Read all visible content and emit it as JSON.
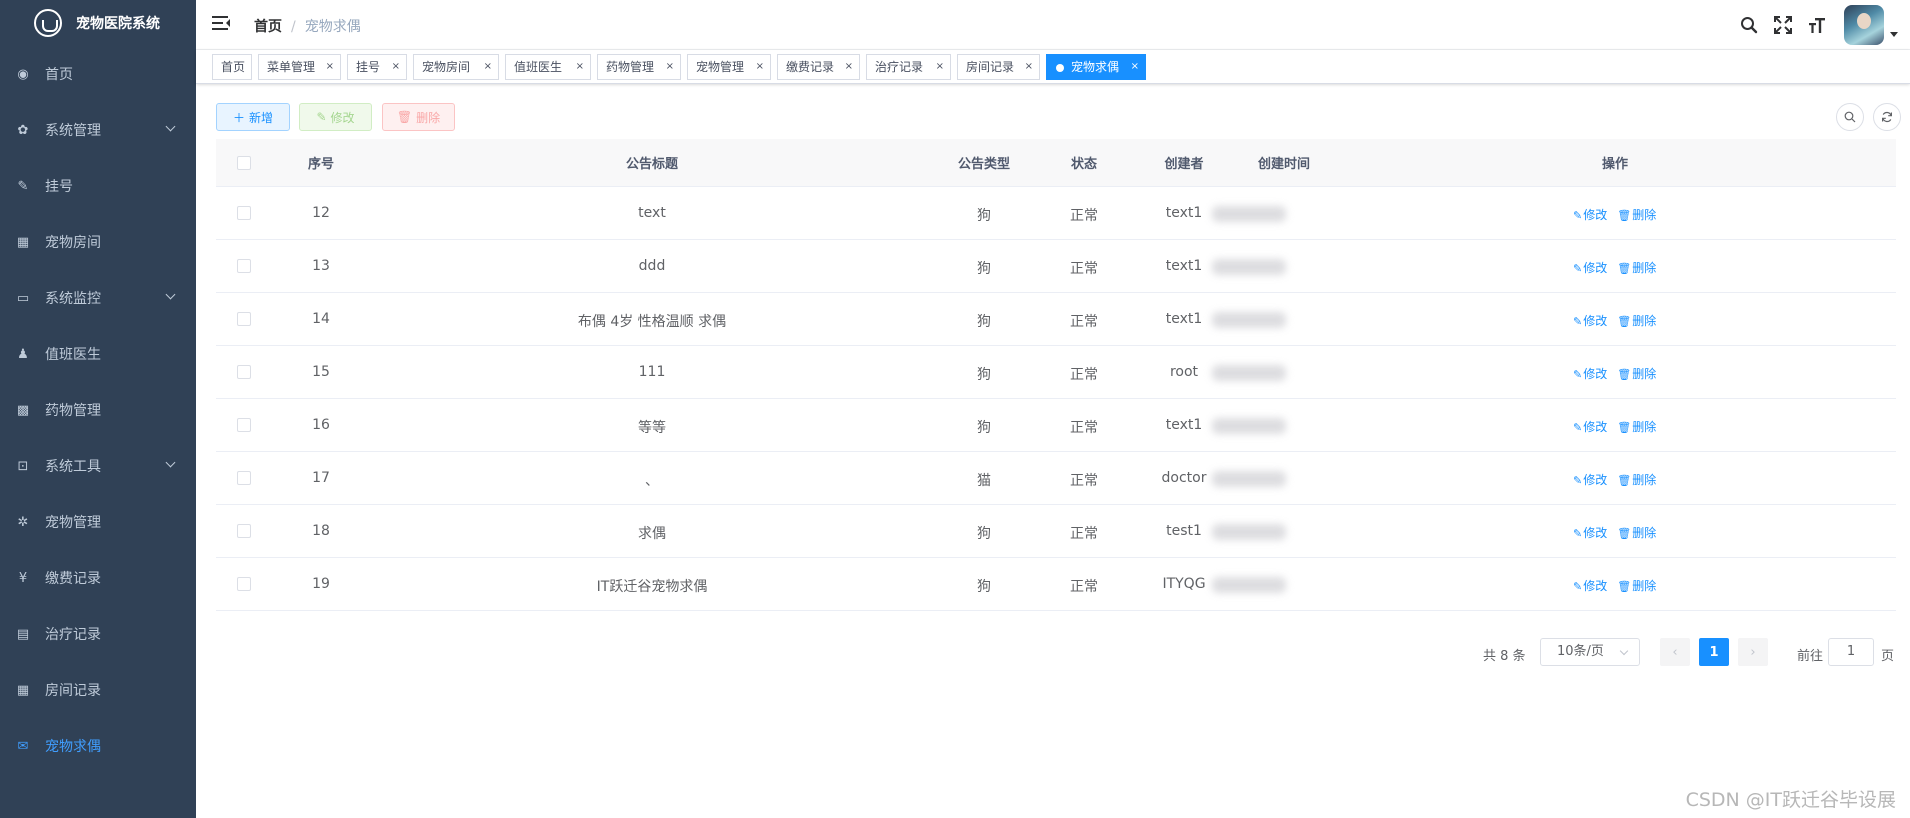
{
  "app": {
    "title": "宠物医院系统"
  },
  "sidebar": {
    "items": [
      {
        "label": "首页",
        "icon": "dashboard-icon",
        "glyph": "◉",
        "expandable": false,
        "active": false
      },
      {
        "label": "系统管理",
        "icon": "gear-icon",
        "glyph": "✿",
        "expandable": true,
        "active": false
      },
      {
        "label": "挂号",
        "icon": "edit-icon",
        "glyph": "✎",
        "expandable": false,
        "active": false
      },
      {
        "label": "宠物房间",
        "icon": "table-icon",
        "glyph": "▦",
        "expandable": false,
        "active": false
      },
      {
        "label": "系统监控",
        "icon": "monitor-icon",
        "glyph": "▭",
        "expandable": true,
        "active": false
      },
      {
        "label": "值班医生",
        "icon": "peoples-icon",
        "glyph": "♟",
        "expandable": false,
        "active": false
      },
      {
        "label": "药物管理",
        "icon": "grid-icon",
        "glyph": "▩",
        "expandable": false,
        "active": false
      },
      {
        "label": "系统工具",
        "icon": "toolbox-icon",
        "glyph": "⊡",
        "expandable": true,
        "active": false
      },
      {
        "label": "宠物管理",
        "icon": "bug-icon",
        "glyph": "✲",
        "expandable": false,
        "active": false
      },
      {
        "label": "缴费记录",
        "icon": "yen-icon",
        "glyph": "¥",
        "expandable": false,
        "active": false
      },
      {
        "label": "治疗记录",
        "icon": "document-icon",
        "glyph": "▤",
        "expandable": false,
        "active": false
      },
      {
        "label": "房间记录",
        "icon": "table-icon",
        "glyph": "▦",
        "expandable": false,
        "active": false
      },
      {
        "label": "宠物求偶",
        "icon": "message-icon",
        "glyph": "✉",
        "expandable": false,
        "active": true
      }
    ]
  },
  "breadcrumb": {
    "home": "首页",
    "separator": "/",
    "current": "宠物求偶"
  },
  "tags": [
    {
      "label": "首页",
      "closable": false,
      "active": false
    },
    {
      "label": "菜单管理",
      "closable": true,
      "active": false
    },
    {
      "label": "挂号",
      "closable": true,
      "active": false
    },
    {
      "label": "宠物房间",
      "closable": true,
      "active": false
    },
    {
      "label": "值班医生",
      "closable": true,
      "active": false
    },
    {
      "label": "药物管理",
      "closable": true,
      "active": false
    },
    {
      "label": "宠物管理",
      "closable": true,
      "active": false
    },
    {
      "label": "缴费记录",
      "closable": true,
      "active": false
    },
    {
      "label": "治疗记录",
      "closable": true,
      "active": false
    },
    {
      "label": "房间记录",
      "closable": true,
      "active": false
    },
    {
      "label": "宠物求偶",
      "closable": true,
      "active": true
    }
  ],
  "toolbar": {
    "add_label": "新增",
    "edit_label": "修改",
    "delete_label": "删除"
  },
  "table": {
    "headers": {
      "index": "序号",
      "title": "公告标题",
      "type": "公告类型",
      "status": "状态",
      "creator": "创建者",
      "created": "创建时间",
      "actions": "操作"
    },
    "rows": [
      {
        "id": "12",
        "title": "text",
        "type": "狗",
        "status": "正常",
        "creator": "text1"
      },
      {
        "id": "13",
        "title": "ddd",
        "type": "狗",
        "status": "正常",
        "creator": "text1"
      },
      {
        "id": "14",
        "title": "布偶 4岁 性格温顺 求偶",
        "type": "狗",
        "status": "正常",
        "creator": "text1"
      },
      {
        "id": "15",
        "title": "111",
        "type": "狗",
        "status": "正常",
        "creator": "root"
      },
      {
        "id": "16",
        "title": "等等",
        "type": "狗",
        "status": "正常",
        "creator": "text1"
      },
      {
        "id": "17",
        "title": "、",
        "type": "猫",
        "status": "正常",
        "creator": "doctor"
      },
      {
        "id": "18",
        "title": "求偶",
        "type": "狗",
        "status": "正常",
        "creator": "test1"
      },
      {
        "id": "19",
        "title": "IT跃迁谷宠物求偶",
        "type": "狗",
        "status": "正常",
        "creator": "ITYQG"
      }
    ],
    "edit_label": "修改",
    "delete_label": "删除"
  },
  "pagination": {
    "total": "共 8 条",
    "page_size": "10条/页",
    "current_page": "1",
    "goto_label": "前往",
    "goto_value": "1",
    "page_suffix": "页"
  },
  "watermark": "CSDN @IT跃迁谷毕设展",
  "colors": {
    "sidebar_bg": "#304156",
    "accent": "#1890ff",
    "active_menu": "#409eff"
  }
}
